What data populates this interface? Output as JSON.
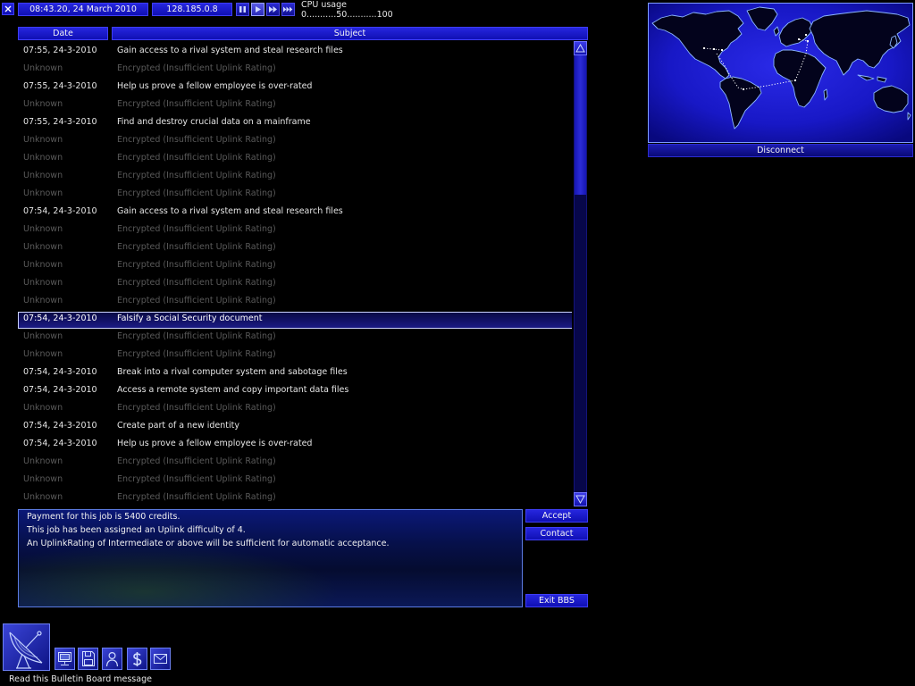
{
  "top_bar": {
    "close_icon": "close-icon",
    "datetime": "08:43.20, 24 March 2010",
    "ip_address": "128.185.0.8",
    "speed_controls": [
      {
        "icon": "pause-icon",
        "active": false
      },
      {
        "icon": "play-icon",
        "active": true
      },
      {
        "icon": "fast-forward-icon",
        "active": false
      },
      {
        "icon": "fastest-forward-icon",
        "active": false
      }
    ],
    "cpu_label": "CPU usage",
    "cpu_scale": "0...........50...........100"
  },
  "map": {
    "disconnect_label": "Disconnect"
  },
  "bulletin_board": {
    "columns": {
      "date": "Date",
      "subject": "Subject"
    },
    "messages": [
      {
        "date": "07:55, 24-3-2010",
        "subject": "Gain access to a rival system and steal research files",
        "encrypted": false
      },
      {
        "date": "Unknown",
        "subject": "Encrypted (Insufficient Uplink Rating)",
        "encrypted": true
      },
      {
        "date": "07:55, 24-3-2010",
        "subject": "Help us prove a fellow employee is over-rated",
        "encrypted": false
      },
      {
        "date": "Unknown",
        "subject": "Encrypted (Insufficient Uplink Rating)",
        "encrypted": true
      },
      {
        "date": "07:55, 24-3-2010",
        "subject": "Find and destroy crucial data on a mainframe",
        "encrypted": false
      },
      {
        "date": "Unknown",
        "subject": "Encrypted (Insufficient Uplink Rating)",
        "encrypted": true
      },
      {
        "date": "Unknown",
        "subject": "Encrypted (Insufficient Uplink Rating)",
        "encrypted": true
      },
      {
        "date": "Unknown",
        "subject": "Encrypted (Insufficient Uplink Rating)",
        "encrypted": true
      },
      {
        "date": "Unknown",
        "subject": "Encrypted (Insufficient Uplink Rating)",
        "encrypted": true
      },
      {
        "date": "07:54, 24-3-2010",
        "subject": "Gain access to a rival system and steal research files",
        "encrypted": false
      },
      {
        "date": "Unknown",
        "subject": "Encrypted (Insufficient Uplink Rating)",
        "encrypted": true
      },
      {
        "date": "Unknown",
        "subject": "Encrypted (Insufficient Uplink Rating)",
        "encrypted": true
      },
      {
        "date": "Unknown",
        "subject": "Encrypted (Insufficient Uplink Rating)",
        "encrypted": true
      },
      {
        "date": "Unknown",
        "subject": "Encrypted (Insufficient Uplink Rating)",
        "encrypted": true
      },
      {
        "date": "Unknown",
        "subject": "Encrypted (Insufficient Uplink Rating)",
        "encrypted": true
      },
      {
        "date": "07:54, 24-3-2010",
        "subject": "Falsify a Social Security document",
        "encrypted": false,
        "selected": true
      },
      {
        "date": "Unknown",
        "subject": "Encrypted (Insufficient Uplink Rating)",
        "encrypted": true
      },
      {
        "date": "Unknown",
        "subject": "Encrypted (Insufficient Uplink Rating)",
        "encrypted": true
      },
      {
        "date": "07:54, 24-3-2010",
        "subject": "Break into a rival computer system and sabotage files",
        "encrypted": false
      },
      {
        "date": "07:54, 24-3-2010",
        "subject": "Access a remote system and copy important data files",
        "encrypted": false
      },
      {
        "date": "Unknown",
        "subject": "Encrypted (Insufficient Uplink Rating)",
        "encrypted": true
      },
      {
        "date": "07:54, 24-3-2010",
        "subject": "Create part of a new identity",
        "encrypted": false
      },
      {
        "date": "07:54, 24-3-2010",
        "subject": "Help us prove a fellow employee is over-rated",
        "encrypted": false
      },
      {
        "date": "Unknown",
        "subject": "Encrypted (Insufficient Uplink Rating)",
        "encrypted": true
      },
      {
        "date": "Unknown",
        "subject": "Encrypted (Insufficient Uplink Rating)",
        "encrypted": true
      },
      {
        "date": "Unknown",
        "subject": "Encrypted (Insufficient Uplink Rating)",
        "encrypted": true
      }
    ],
    "scrollbar": {
      "up_icon": "arrow-up-icon",
      "down_icon": "arrow-down-icon",
      "thumb_position": 0,
      "thumb_size": 0.32
    },
    "details": [
      "Payment for this job is 5400 credits.",
      "This job has been assigned an Uplink difficulty of 4.",
      "An UplinkRating of Intermediate or above will be sufficient for automatic acceptance."
    ],
    "buttons": {
      "accept": "Accept",
      "contact": "Contact",
      "exit": "Exit BBS"
    }
  },
  "toolbar": {
    "icons": [
      "satellite-dish-icon",
      "computer-icon",
      "floppy-disk-icon",
      "person-icon",
      "dollar-icon",
      "envelope-icon"
    ]
  },
  "status_text": "Read this Bulletin Board message",
  "colors": {
    "background": "#000000",
    "panel_blue": "#1a1ad0",
    "text_active": "#e6e6e6",
    "text_encrypted": "#5a5a5a",
    "selection_border": "#cdd4ff"
  }
}
